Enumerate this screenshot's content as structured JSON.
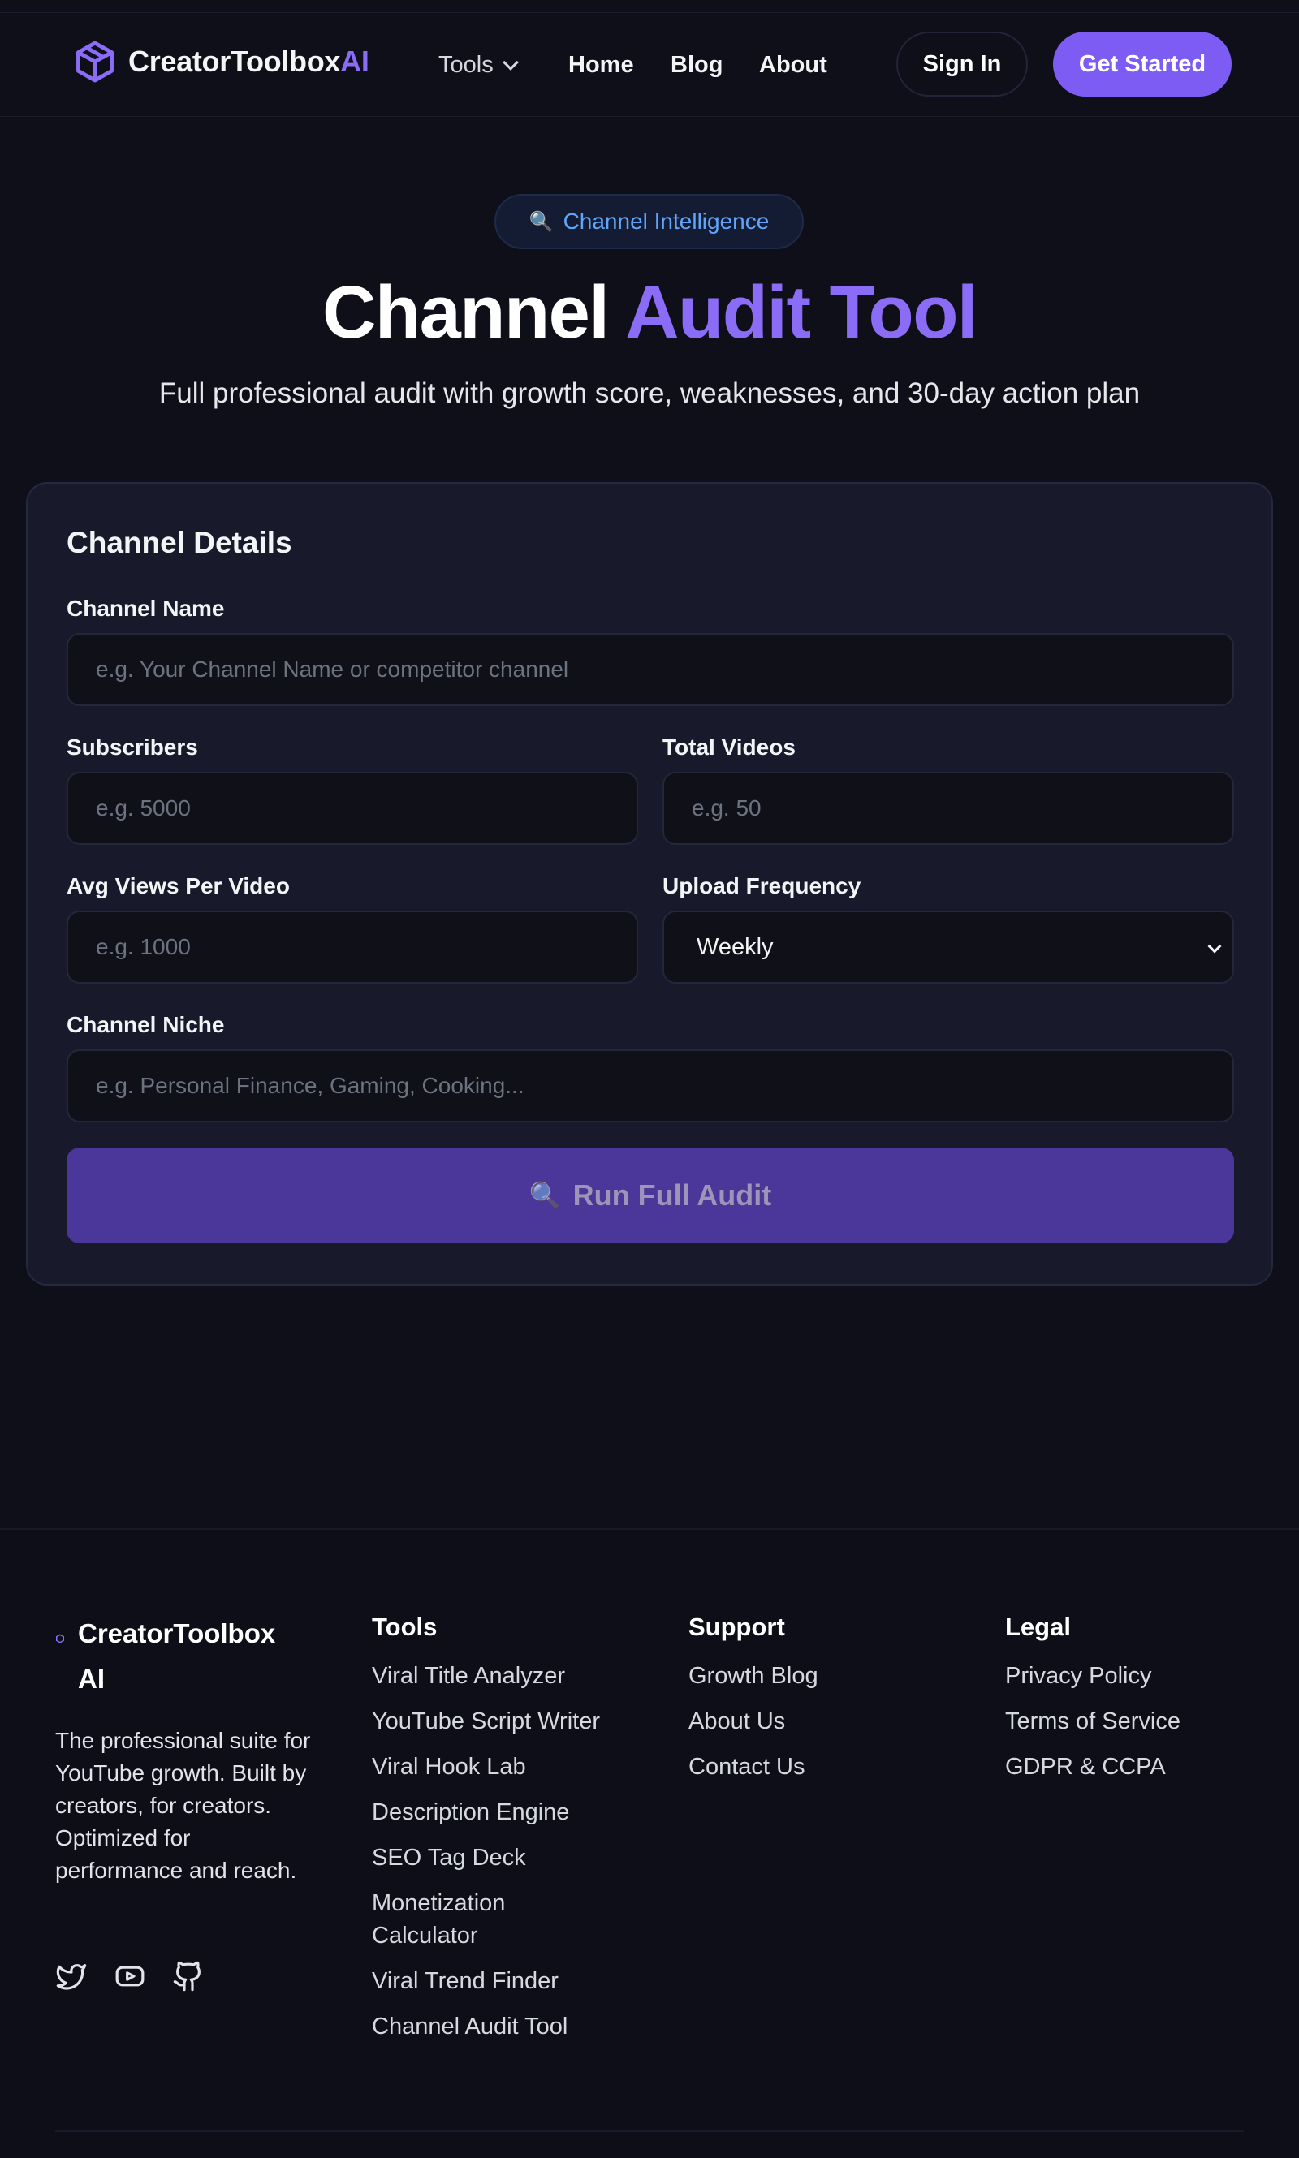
{
  "nav": {
    "logo_main": "CreatorToolbox",
    "logo_accent": "AI",
    "tools": "Tools",
    "home": "Home",
    "blog": "Blog",
    "about": "About",
    "sign_in": "Sign In",
    "get_started": "Get Started"
  },
  "hero": {
    "badge": "Channel Intelligence",
    "title_main": "Channel",
    "title_accent": "Audit Tool",
    "subtitle": "Full professional audit with growth score, weaknesses, and 30-day action plan"
  },
  "form": {
    "title": "Channel Details",
    "channel_name_label": "Channel Name",
    "channel_name_placeholder": "e.g. Your Channel Name or competitor channel",
    "subscribers_label": "Subscribers",
    "subscribers_placeholder": "e.g. 5000",
    "total_videos_label": "Total Videos",
    "total_videos_placeholder": "e.g. 50",
    "avg_views_label": "Avg Views Per Video",
    "avg_views_placeholder": "e.g. 1000",
    "upload_frequency_label": "Upload Frequency",
    "upload_frequency_value": "Weekly",
    "niche_label": "Channel Niche",
    "niche_placeholder": "e.g. Personal Finance, Gaming, Cooking...",
    "submit": "Run Full Audit"
  },
  "footer": {
    "brand_line1": "CreatorToolbox",
    "brand_line2": "AI",
    "description": "The professional suite for YouTube growth. Built by creators, for creators. Optimized for performance and reach.",
    "tools_title": "Tools",
    "tools": [
      "Viral Title Analyzer",
      "YouTube Script Writer",
      "Viral Hook Lab",
      "Description Engine",
      "SEO Tag Deck",
      "Monetization Calculator",
      "Viral Trend Finder",
      "Channel Audit Tool"
    ],
    "support_title": "Support",
    "support": [
      "Growth Blog",
      "About Us",
      "Contact Us"
    ],
    "legal_title": "Legal",
    "legal": [
      "Privacy Policy",
      "Terms of Service",
      "GDPR & CCPA"
    ]
  },
  "icons": {
    "logo": "cube-icon",
    "badge": "magnifier-icon",
    "submit": "magnifier-icon",
    "social": [
      "twitter-icon",
      "youtube-icon",
      "github-icon"
    ]
  },
  "colors": {
    "background": "#0f0f1a",
    "accent": "#7c5cf2",
    "accent_text": "#8b6cf7",
    "badge_text": "#60a5fa",
    "card": "#181a2c",
    "submit_disabled": "#4a3799"
  }
}
